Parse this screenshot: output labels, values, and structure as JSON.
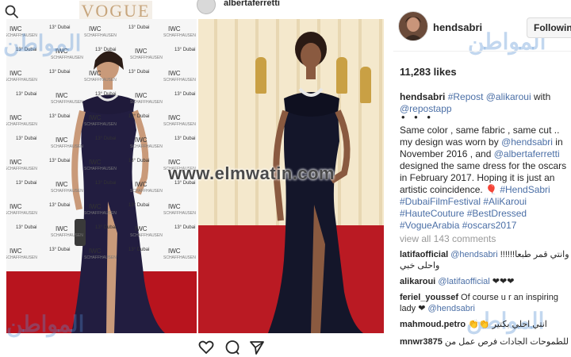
{
  "top": {
    "vogue_logo": "VOGUE",
    "top_username": "albertaferretti"
  },
  "post": {
    "username": "hendsabri",
    "follow_label": "Followin",
    "likes": "11,283 likes",
    "caption": {
      "author": "hendsabri",
      "line1_tag": "#Repost",
      "line1_mention": "@alikaroui",
      "line1_with": "with",
      "line2_mention": "@repostapp",
      "dots": "• • •",
      "text1": "Same color , same fabric , same cut .. my design was worn by",
      "mention1": "@hendsabri",
      "text2": "in November 2016 , and",
      "mention2": "@albertaferretti",
      "text3": "designed the same dress for the oscars in February 2017. Hoping it is just an artistic coincidence. 🎈",
      "tags": [
        "#HendSabri",
        "#DubaiFilmFestival",
        "#AliKaroui",
        "#HauteCouture",
        "#BestDressed",
        "#VogueArabia",
        "#oscars2017"
      ]
    },
    "view_all": "view all 143 comments",
    "comments": [
      {
        "user": "latifaofficial",
        "mention": "@hendsabri",
        "text": "وانتي قمر طبعا!!!!!! واحلى خبي"
      },
      {
        "user": "alikaroui",
        "mention": "@latifaofficial",
        "text": "❤❤❤"
      },
      {
        "user": "feriel_youssef",
        "mention": "",
        "text": "Of course u r an inspiring lady ❤"
      },
      {
        "user": "",
        "mention": "@hendsabri",
        "text": ""
      },
      {
        "user": "mahmoud.petro",
        "mention": "",
        "text": "انتي احلي بكتير 👏👏"
      },
      {
        "user": "mnwr3875",
        "mention": "",
        "text": "للطموحات الجادات فرص عمل من"
      }
    ]
  },
  "photo": {
    "wall_logo": "IWC",
    "wall_logo_sub": "SCHAFFHAUSEN",
    "wall_dff": "13° Dubai",
    "watermark_url": "www.elmwatin.com",
    "watermark_ar": "المواطن"
  },
  "actions": [
    "heart-icon",
    "comment-icon",
    "share-icon"
  ]
}
